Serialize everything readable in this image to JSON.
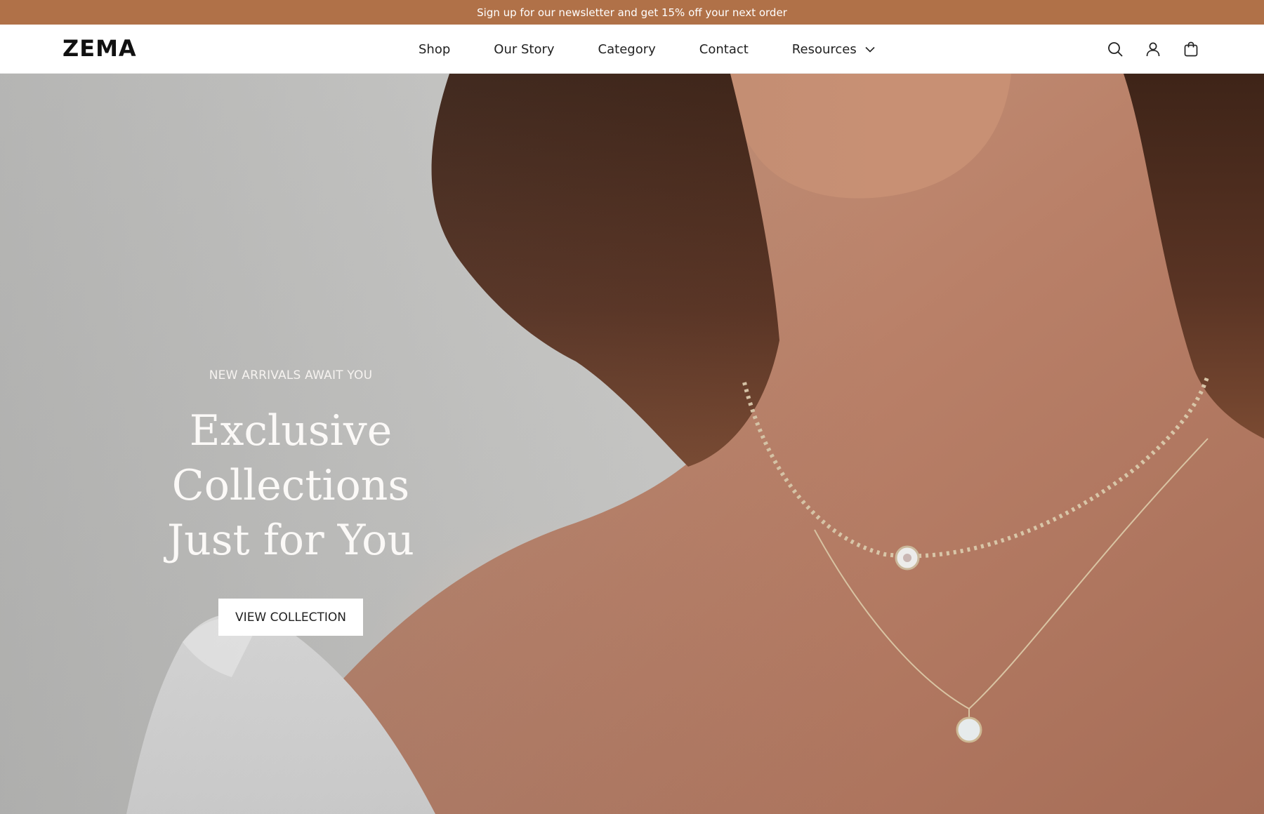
{
  "announcement": {
    "text": "Sign up for our newsletter and get 15% off your next order"
  },
  "header": {
    "logo": "ZEMA",
    "nav": [
      {
        "label": "Shop"
      },
      {
        "label": "Our Story"
      },
      {
        "label": "Category"
      },
      {
        "label": "Contact"
      },
      {
        "label": "Resources",
        "icon": "chevron-down-icon"
      }
    ],
    "icons": [
      "search-icon",
      "account-icon",
      "cart-icon"
    ]
  },
  "hero": {
    "eyebrow": "NEW ARRIVALS AWAIT YOU",
    "headline_line1": "Exclusive Collections",
    "headline_line2": "Just for You",
    "cta_label": "VIEW COLLECTION"
  },
  "colors": {
    "announcement_bg": "#b07148",
    "announcement_text": "#ffffff",
    "header_bg": "#ffffff",
    "cta_bg": "#ffffff"
  }
}
